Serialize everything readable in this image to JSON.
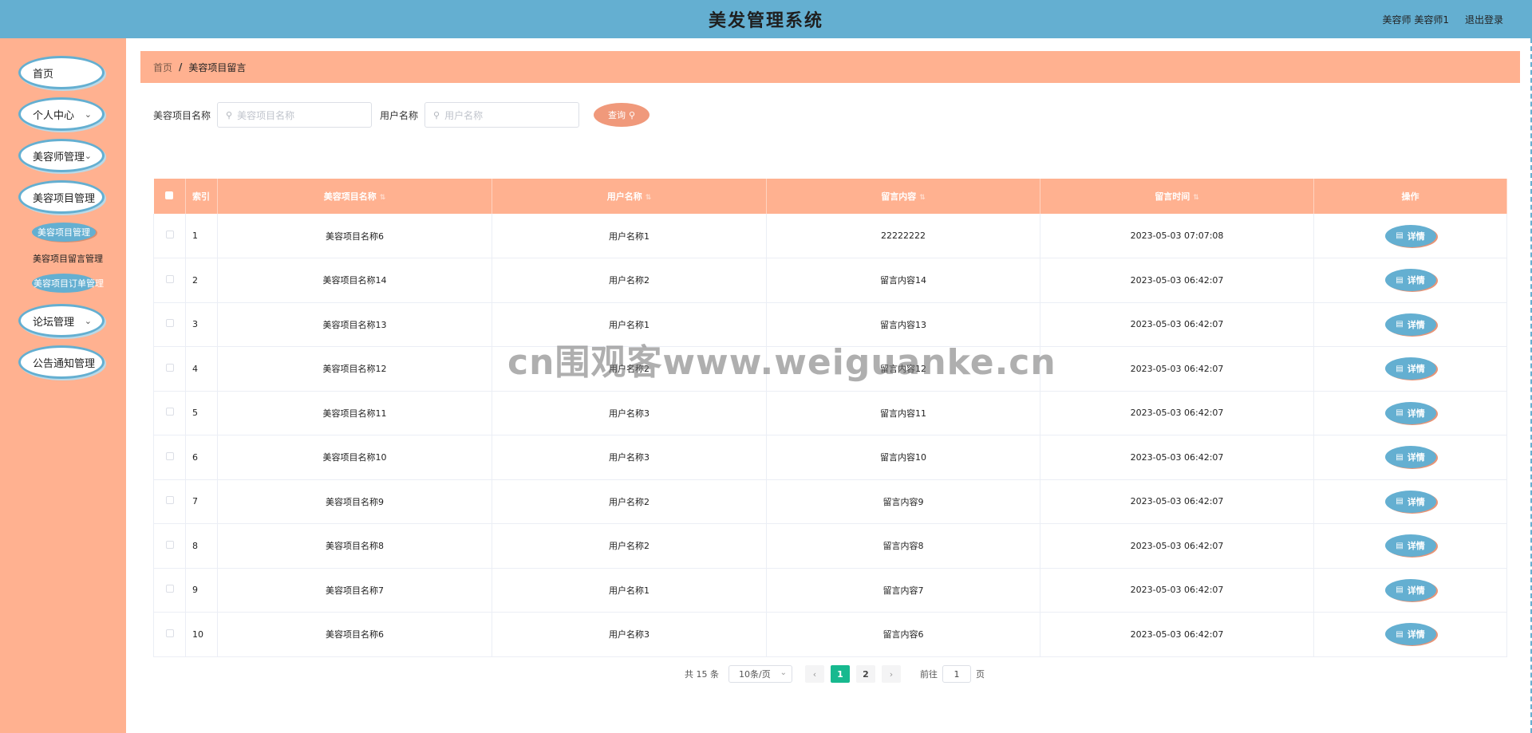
{
  "header": {
    "title": "美发管理系统",
    "user": "美容师 美容师1",
    "logout": "退出登录"
  },
  "sidebar": {
    "items": [
      {
        "label": "首页"
      },
      {
        "label": "个人中心"
      },
      {
        "label": "美容师管理"
      },
      {
        "label": "美容项目管理"
      },
      {
        "label": "论坛管理"
      },
      {
        "label": "公告通知管理"
      }
    ],
    "sub": {
      "active": "美容项目管理",
      "message": "美容项目留言管理",
      "order": "美容项目订单管理"
    }
  },
  "breadcrumb": {
    "home": "首页",
    "sep": "/",
    "current": "美容项目留言"
  },
  "search": {
    "project_label": "美容项目名称",
    "project_placeholder": "美容项目名称",
    "user_label": "用户名称",
    "user_placeholder": "用户名称",
    "query_label": "查询"
  },
  "table": {
    "headers": [
      "索引",
      "美容项目名称",
      "用户名称",
      "留言内容",
      "留言时间",
      "操作"
    ],
    "detail_label": "详情",
    "rows": [
      {
        "index": "1",
        "project": "美容项目名称6",
        "user": "用户名称1",
        "content": "22222222",
        "time": "2023-05-03 07:07:08"
      },
      {
        "index": "2",
        "project": "美容项目名称14",
        "user": "用户名称2",
        "content": "留言内容14",
        "time": "2023-05-03 06:42:07"
      },
      {
        "index": "3",
        "project": "美容项目名称13",
        "user": "用户名称1",
        "content": "留言内容13",
        "time": "2023-05-03 06:42:07"
      },
      {
        "index": "4",
        "project": "美容项目名称12",
        "user": "用户名称2",
        "content": "留言内容12",
        "time": "2023-05-03 06:42:07"
      },
      {
        "index": "5",
        "project": "美容项目名称11",
        "user": "用户名称3",
        "content": "留言内容11",
        "time": "2023-05-03 06:42:07"
      },
      {
        "index": "6",
        "project": "美容项目名称10",
        "user": "用户名称3",
        "content": "留言内容10",
        "time": "2023-05-03 06:42:07"
      },
      {
        "index": "7",
        "project": "美容项目名称9",
        "user": "用户名称2",
        "content": "留言内容9",
        "time": "2023-05-03 06:42:07"
      },
      {
        "index": "8",
        "project": "美容项目名称8",
        "user": "用户名称2",
        "content": "留言内容8",
        "time": "2023-05-03 06:42:07"
      },
      {
        "index": "9",
        "project": "美容项目名称7",
        "user": "用户名称1",
        "content": "留言内容7",
        "time": "2023-05-03 06:42:07"
      },
      {
        "index": "10",
        "project": "美容项目名称6",
        "user": "用户名称3",
        "content": "留言内容6",
        "time": "2023-05-03 06:42:07"
      }
    ]
  },
  "pagination": {
    "total": "共 15 条",
    "page_size": "10条/页",
    "pages": [
      "1",
      "2"
    ],
    "current": "1",
    "goto_label": "前往",
    "goto_value": "1",
    "page_suffix": "页"
  },
  "watermark": "cn围观客www.weiguanke.cn",
  "colors": {
    "header_bg": "#64afd1",
    "sidebar_bg": "#ffb190",
    "accent_blue": "#64afd1",
    "table_header_bg": "#ffb190",
    "query_button": "#f0997b",
    "page_active": "#17b98f"
  }
}
